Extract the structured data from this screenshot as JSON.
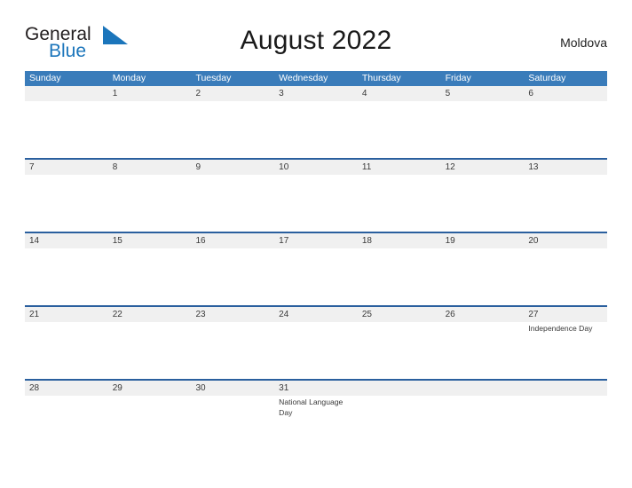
{
  "brand": {
    "name_part1": "General",
    "name_part2": "Blue",
    "flag_icon": "blue-triangle-flag-icon",
    "primary_color": "#1b75bb"
  },
  "header": {
    "title": "August 2022",
    "country": "Moldova"
  },
  "colors": {
    "header_blue": "#3a7cba",
    "row_rule_blue": "#2a5f9e",
    "row_band_gray": "#f0f0f0",
    "text": "#3a3a3a"
  },
  "calendar": {
    "month": "August",
    "year": "2022",
    "weekdays": [
      "Sunday",
      "Monday",
      "Tuesday",
      "Wednesday",
      "Thursday",
      "Friday",
      "Saturday"
    ],
    "weeks": [
      {
        "days": [
          {
            "num": "",
            "event": ""
          },
          {
            "num": "1",
            "event": ""
          },
          {
            "num": "2",
            "event": ""
          },
          {
            "num": "3",
            "event": ""
          },
          {
            "num": "4",
            "event": ""
          },
          {
            "num": "5",
            "event": ""
          },
          {
            "num": "6",
            "event": ""
          }
        ]
      },
      {
        "days": [
          {
            "num": "7",
            "event": ""
          },
          {
            "num": "8",
            "event": ""
          },
          {
            "num": "9",
            "event": ""
          },
          {
            "num": "10",
            "event": ""
          },
          {
            "num": "11",
            "event": ""
          },
          {
            "num": "12",
            "event": ""
          },
          {
            "num": "13",
            "event": ""
          }
        ]
      },
      {
        "days": [
          {
            "num": "14",
            "event": ""
          },
          {
            "num": "15",
            "event": ""
          },
          {
            "num": "16",
            "event": ""
          },
          {
            "num": "17",
            "event": ""
          },
          {
            "num": "18",
            "event": ""
          },
          {
            "num": "19",
            "event": ""
          },
          {
            "num": "20",
            "event": ""
          }
        ]
      },
      {
        "days": [
          {
            "num": "21",
            "event": ""
          },
          {
            "num": "22",
            "event": ""
          },
          {
            "num": "23",
            "event": ""
          },
          {
            "num": "24",
            "event": ""
          },
          {
            "num": "25",
            "event": ""
          },
          {
            "num": "26",
            "event": ""
          },
          {
            "num": "27",
            "event": "Independence Day"
          }
        ]
      },
      {
        "days": [
          {
            "num": "28",
            "event": ""
          },
          {
            "num": "29",
            "event": ""
          },
          {
            "num": "30",
            "event": ""
          },
          {
            "num": "31",
            "event": "National Language Day"
          },
          {
            "num": "",
            "event": ""
          },
          {
            "num": "",
            "event": ""
          },
          {
            "num": "",
            "event": ""
          }
        ]
      }
    ]
  }
}
